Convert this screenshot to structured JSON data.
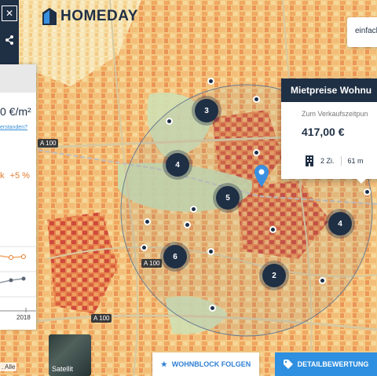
{
  "brand": {
    "name": "HOMEDAY"
  },
  "top_right": {
    "label": "einfach"
  },
  "roads": [
    "A 100",
    "A 100",
    "A 100"
  ],
  "left_panel": {
    "price": "0 €/m²",
    "link": "erstanden?",
    "change_k": "k",
    "change_pct": "+5 %",
    "year": "2018"
  },
  "map_labels": {
    "satellite": "Satellit",
    "alle": ". Alle"
  },
  "clusters": [
    "3",
    "4",
    "5",
    "6",
    "2",
    "4"
  ],
  "popup": {
    "title": "Mietpreise Wohnu",
    "subtitle": "Zum Verkaufszeitpun",
    "value": "417,00 €",
    "rooms": "2 Zi.",
    "area": "61 m"
  },
  "buttons": {
    "follow": "WOHNBLOCK FOLGEN",
    "detail": "DETAILBEWERTUNG"
  },
  "colors": {
    "primary": "#1f2f44",
    "accent_blue": "#2f8fe0",
    "orange": "#e27b2c"
  },
  "icons": [
    "close-icon",
    "share-icon",
    "layers-icon",
    "star-icon",
    "tag-icon",
    "building-icon",
    "location-pin-icon"
  ]
}
